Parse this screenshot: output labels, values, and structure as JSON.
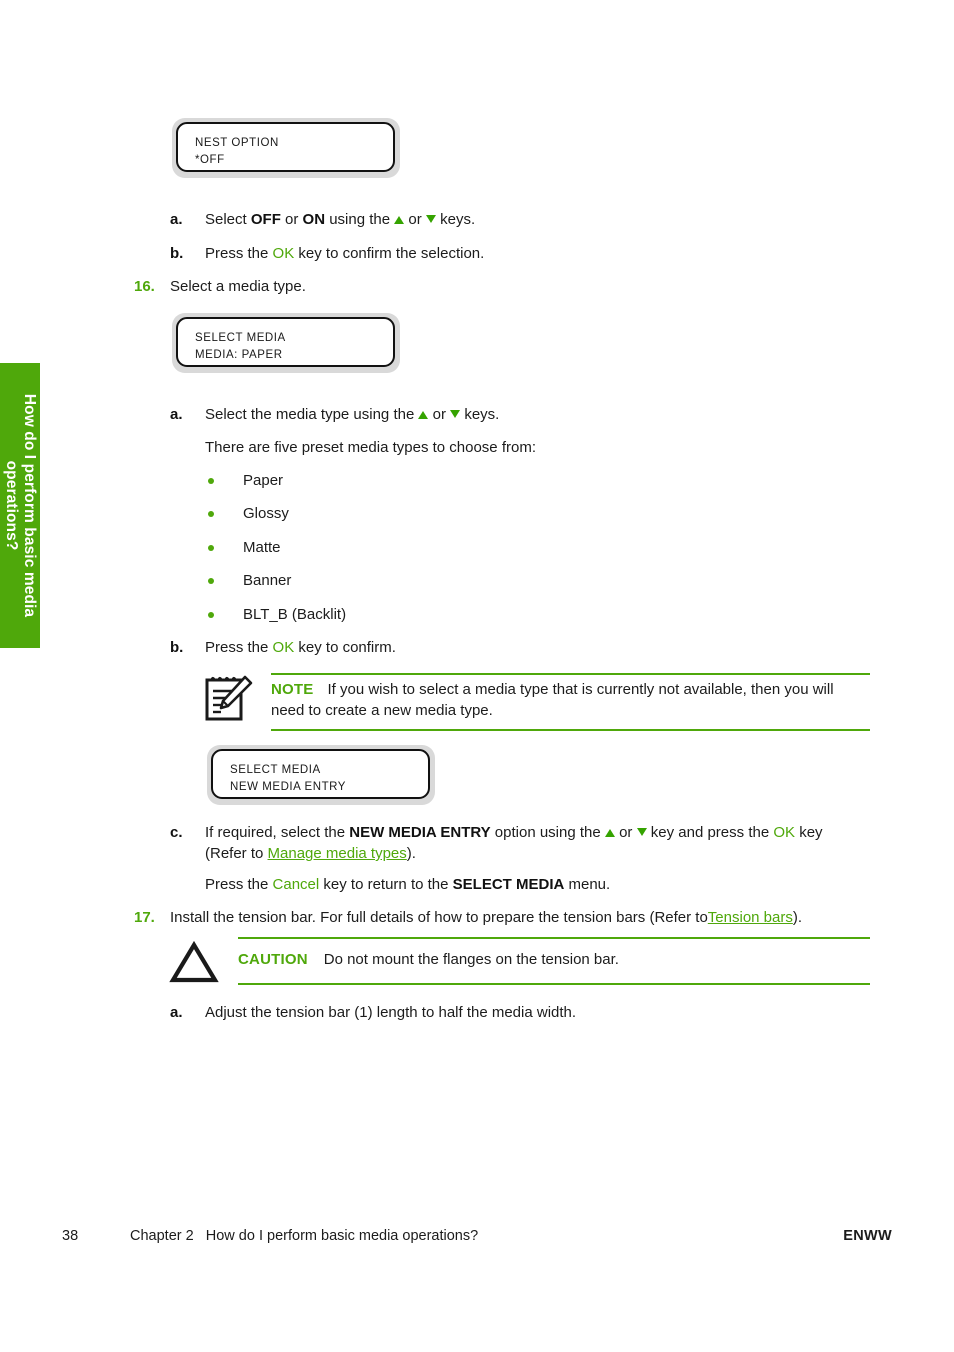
{
  "page": {
    "side_tab_label": "How do I perform basic media operations?",
    "footer": {
      "page_number": "38",
      "chapter": "Chapter 2   How do I perform basic media operations?",
      "publication": "ENWW"
    },
    "accent_green": "#4fa80b",
    "text_color": "#1c1c1c"
  },
  "displays": {
    "nest_option": {
      "line1": "NEST OPTION",
      "line2": "*OFF"
    },
    "select_media_paper": {
      "line1": "SELECT MEDIA",
      "line2": "MEDIA: PAPER"
    },
    "select_media_new_entry": {
      "line1": "SELECT MEDIA",
      "line2": "NEW MEDIA ENTRY"
    }
  },
  "steps": {
    "nest_a": {
      "marker": "a.",
      "t1": "Select ",
      "b1": "OFF",
      "t2": " or ",
      "b2": "ON",
      "t3": " using the ",
      "t4": " or ",
      "t5": " keys."
    },
    "nest_b": {
      "marker": "b.",
      "t1": "Press the ",
      "g1": "OK",
      "t2": " key to confirm the selection."
    },
    "step16": {
      "marker": "16.",
      "text": "Select a media type."
    },
    "media_a": {
      "marker": "a.",
      "t1": "Select the media type using the ",
      "t2": " or ",
      "t3": " keys."
    },
    "media_intro": {
      "text": "There are five preset media types to choose from:"
    },
    "media_types": [
      "Paper",
      "Glossy",
      "Matte",
      "Banner",
      "BLT_B (Backlit)"
    ],
    "media_b": {
      "marker": "b.",
      "t1": "Press the ",
      "g1": "OK",
      "t2": " key to confirm."
    },
    "media_c": {
      "marker": "c.",
      "t1": "If required, select the ",
      "b1": "NEW MEDIA ENTRY",
      "t2": " option using the ",
      "t3": " or ",
      "t4": " key and press the ",
      "g1": "OK",
      "t5": " key",
      "t6": "(Refer to ",
      "link1": "Manage media types",
      "t7": ")."
    },
    "media_cancel": {
      "t1": "Press the ",
      "g1": "Cancel",
      "t2": " key to return to the ",
      "b1": "SELECT MEDIA",
      "t3": " menu."
    },
    "step17": {
      "marker": "17.",
      "t1": "Install the tension bar. For full details of how to prepare the tension bars (Refer to",
      "link1": "Tension bars",
      "t2": ")."
    },
    "tension_a": {
      "marker": "a.",
      "text": "Adjust the tension bar (1) length to half the media width."
    }
  },
  "admonitions": {
    "note": {
      "icon": "notepad-pencil-icon",
      "label": "NOTE",
      "line1": "If you wish to select a media type that is currently not available, then you will",
      "line2": "need to create a new media type."
    },
    "caution": {
      "icon": "warning-triangle-icon",
      "label": "CAUTION",
      "text": "Do not mount the flanges on the tension bar."
    }
  }
}
